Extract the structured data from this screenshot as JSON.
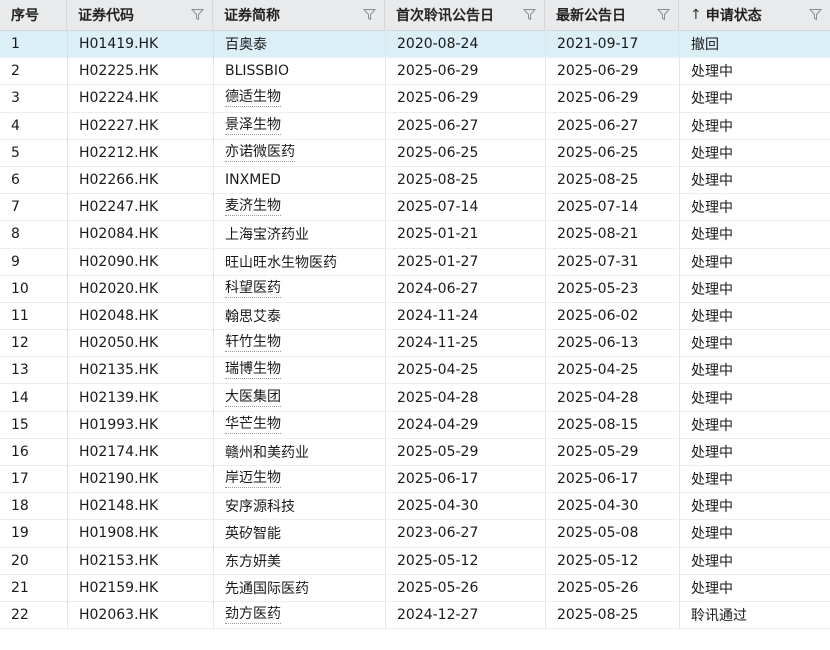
{
  "table": {
    "columns": [
      {
        "key": "idx",
        "label": "序号",
        "filter": false
      },
      {
        "key": "code",
        "label": "证券代码",
        "filter": true
      },
      {
        "key": "name",
        "label": "证券简称",
        "filter": true
      },
      {
        "key": "first_date",
        "label": "首次聆讯公告日",
        "filter": true
      },
      {
        "key": "latest_date",
        "label": "最新公告日",
        "filter": true
      },
      {
        "key": "status",
        "label": "申请状态",
        "filter": true,
        "sort": "↑"
      }
    ],
    "rows": [
      {
        "idx": "1",
        "code": "H01419.HK",
        "name": "百奥泰",
        "first_date": "2020-08-24",
        "latest_date": "2021-09-17",
        "status": "撤回",
        "link": false,
        "highlight": true
      },
      {
        "idx": "2",
        "code": "H02225.HK",
        "name": "BLISSBIO",
        "first_date": "2025-06-29",
        "latest_date": "2025-06-29",
        "status": "处理中",
        "link": false
      },
      {
        "idx": "3",
        "code": "H02224.HK",
        "name": "德适生物",
        "first_date": "2025-06-29",
        "latest_date": "2025-06-29",
        "status": "处理中",
        "link": true
      },
      {
        "idx": "4",
        "code": "H02227.HK",
        "name": "景泽生物",
        "first_date": "2025-06-27",
        "latest_date": "2025-06-27",
        "status": "处理中",
        "link": true
      },
      {
        "idx": "5",
        "code": "H02212.HK",
        "name": "亦诺微医药",
        "first_date": "2025-06-25",
        "latest_date": "2025-06-25",
        "status": "处理中",
        "link": true
      },
      {
        "idx": "6",
        "code": "H02266.HK",
        "name": "INXMED",
        "first_date": "2025-08-25",
        "latest_date": "2025-08-25",
        "status": "处理中",
        "link": false
      },
      {
        "idx": "7",
        "code": "H02247.HK",
        "name": "麦济生物",
        "first_date": "2025-07-14",
        "latest_date": "2025-07-14",
        "status": "处理中",
        "link": true
      },
      {
        "idx": "8",
        "code": "H02084.HK",
        "name": "上海宝济药业",
        "first_date": "2025-01-21",
        "latest_date": "2025-08-21",
        "status": "处理中",
        "link": false
      },
      {
        "idx": "9",
        "code": "H02090.HK",
        "name": "旺山旺水生物医药",
        "first_date": "2025-01-27",
        "latest_date": "2025-07-31",
        "status": "处理中",
        "link": false
      },
      {
        "idx": "10",
        "code": "H02020.HK",
        "name": "科望医药",
        "first_date": "2024-06-27",
        "latest_date": "2025-05-23",
        "status": "处理中",
        "link": true
      },
      {
        "idx": "11",
        "code": "H02048.HK",
        "name": "翰思艾泰",
        "first_date": "2024-11-24",
        "latest_date": "2025-06-02",
        "status": "处理中",
        "link": false
      },
      {
        "idx": "12",
        "code": "H02050.HK",
        "name": "轩竹生物",
        "first_date": "2024-11-25",
        "latest_date": "2025-06-13",
        "status": "处理中",
        "link": true
      },
      {
        "idx": "13",
        "code": "H02135.HK",
        "name": "瑞博生物",
        "first_date": "2025-04-25",
        "latest_date": "2025-04-25",
        "status": "处理中",
        "link": true
      },
      {
        "idx": "14",
        "code": "H02139.HK",
        "name": "大医集团",
        "first_date": "2025-04-28",
        "latest_date": "2025-04-28",
        "status": "处理中",
        "link": true
      },
      {
        "idx": "15",
        "code": "H01993.HK",
        "name": "华芒生物",
        "first_date": "2024-04-29",
        "latest_date": "2025-08-15",
        "status": "处理中",
        "link": true
      },
      {
        "idx": "16",
        "code": "H02174.HK",
        "name": "赣州和美药业",
        "first_date": "2025-05-29",
        "latest_date": "2025-05-29",
        "status": "处理中",
        "link": false
      },
      {
        "idx": "17",
        "code": "H02190.HK",
        "name": "岸迈生物",
        "first_date": "2025-06-17",
        "latest_date": "2025-06-17",
        "status": "处理中",
        "link": true
      },
      {
        "idx": "18",
        "code": "H02148.HK",
        "name": "安序源科技",
        "first_date": "2025-04-30",
        "latest_date": "2025-04-30",
        "status": "处理中",
        "link": false
      },
      {
        "idx": "19",
        "code": "H01908.HK",
        "name": "英矽智能",
        "first_date": "2023-06-27",
        "latest_date": "2025-05-08",
        "status": "处理中",
        "link": false
      },
      {
        "idx": "20",
        "code": "H02153.HK",
        "name": "东方妍美",
        "first_date": "2025-05-12",
        "latest_date": "2025-05-12",
        "status": "处理中",
        "link": false
      },
      {
        "idx": "21",
        "code": "H02159.HK",
        "name": "先通国际医药",
        "first_date": "2025-05-26",
        "latest_date": "2025-05-26",
        "status": "处理中",
        "link": false
      },
      {
        "idx": "22",
        "code": "H02063.HK",
        "name": "劲方医药",
        "first_date": "2024-12-27",
        "latest_date": "2025-08-25",
        "status": "聆讯通过",
        "link": true
      }
    ]
  },
  "icons": {
    "filter": "filter-icon",
    "sort": "sort-up-arrow"
  },
  "colors": {
    "header_bg": "#e9eaec",
    "highlight_row": "#dbeff7",
    "border": "#d6d8db"
  }
}
